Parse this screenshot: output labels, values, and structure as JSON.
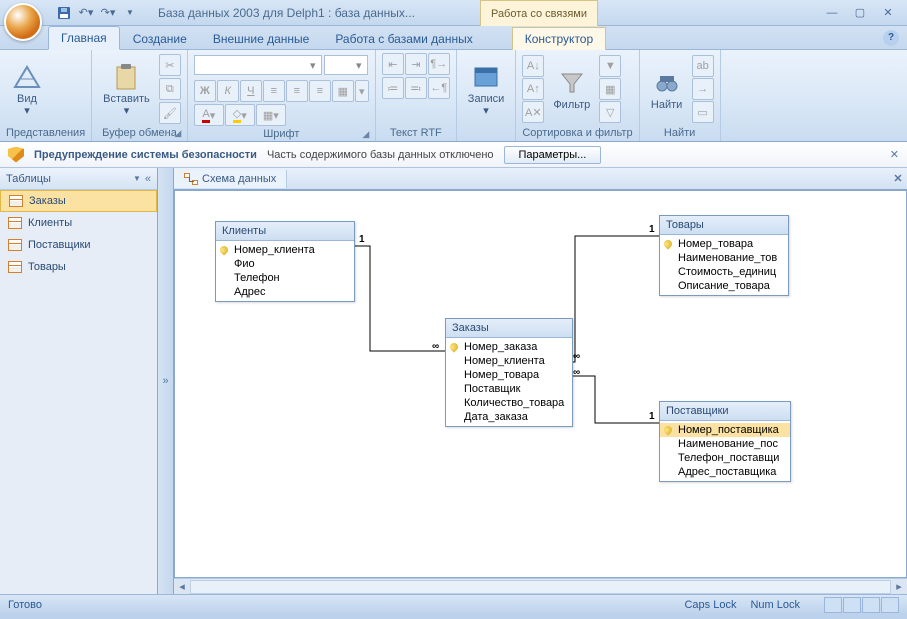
{
  "title": "База данных 2003 для Delph1 : база данных...",
  "context_tab_group": "Работа со связями",
  "tabs": [
    "Главная",
    "Создание",
    "Внешние данные",
    "Работа с базами данных",
    "Конструктор"
  ],
  "ribbon": {
    "view": "Вид",
    "views_group": "Представления",
    "paste": "Вставить",
    "clipboard_group": "Буфер обмена",
    "font_group": "Шрифт",
    "rtf_group": "Текст RTF",
    "records": "Записи",
    "filter": "Фильтр",
    "sortfilter_group": "Сортировка и фильтр",
    "find": "Найти",
    "find_group": "Найти"
  },
  "security": {
    "title": "Предупреждение системы безопасности",
    "text": "Часть содержимого базы данных отключено",
    "button": "Параметры..."
  },
  "nav": {
    "header": "Таблицы",
    "items": [
      "Заказы",
      "Клиенты",
      "Поставщики",
      "Товары"
    ]
  },
  "doc_tab": "Схема данных",
  "entities": {
    "clients": {
      "title": "Клиенты",
      "fields": [
        "Номер_клиента",
        "Фио",
        "Телефон",
        "Адрес"
      ]
    },
    "orders": {
      "title": "Заказы",
      "fields": [
        "Номер_заказа",
        "Номер_клиента",
        "Номер_товара",
        "Поставщик",
        "Количество_товара",
        "Дата_заказа"
      ]
    },
    "goods": {
      "title": "Товары",
      "fields": [
        "Номер_товара",
        "Наименование_тов",
        "Стоимость_единиц",
        "Описание_товара"
      ]
    },
    "suppliers": {
      "title": "Поставщики",
      "fields": [
        "Номер_поставщика",
        "Наименование_пос",
        "Телефон_поставщи",
        "Адрес_поставщика"
      ]
    }
  },
  "rel_labels": {
    "one": "1",
    "many": "∞"
  },
  "status": {
    "ready": "Готово",
    "caps": "Caps Lock",
    "num": "Num Lock"
  }
}
